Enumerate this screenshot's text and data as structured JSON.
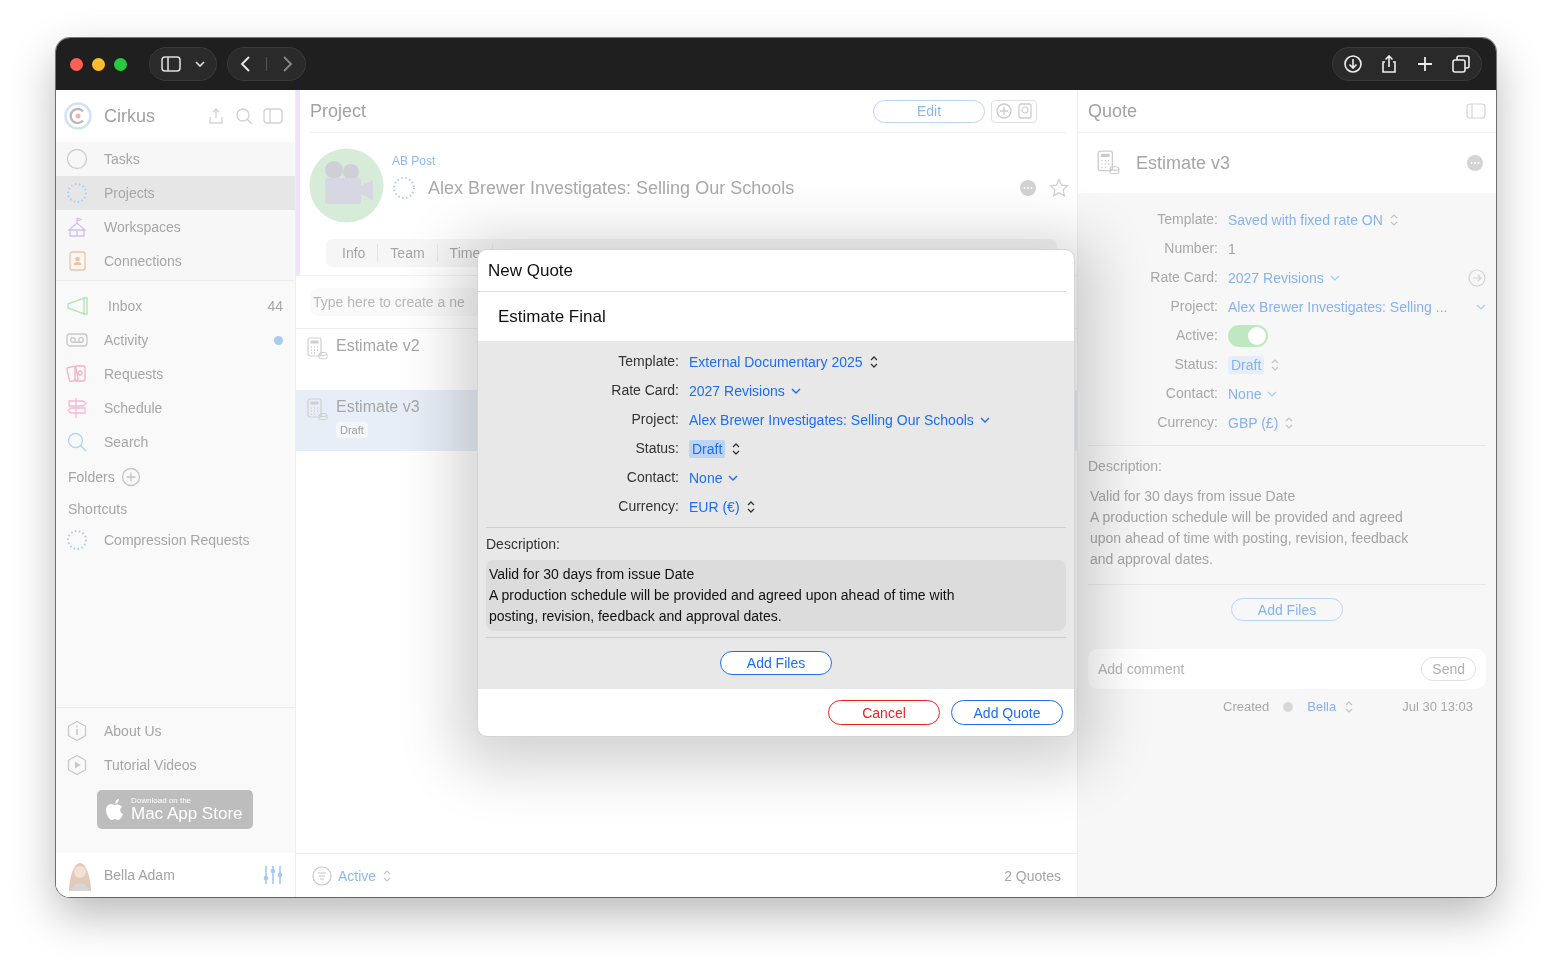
{
  "sidebar": {
    "app_name": "Cirkus",
    "nav": [
      {
        "label": "Tasks",
        "selected": false
      },
      {
        "label": "Projects",
        "selected": true
      },
      {
        "label": "Workspaces",
        "selected": false
      },
      {
        "label": "Connections",
        "selected": false
      }
    ],
    "inbox": [
      {
        "label": "Inbox",
        "count": "44",
        "unread": false
      },
      {
        "label": "Activity",
        "unread": true
      },
      {
        "label": "Requests",
        "unread": false
      },
      {
        "label": "Schedule",
        "unread": false
      },
      {
        "label": "Search",
        "unread": false
      }
    ],
    "folders_label": "Folders",
    "shortcuts_label": "Shortcuts",
    "shortcuts": [
      {
        "label": "Compression Requests"
      }
    ],
    "footer_links": [
      {
        "label": "About Us"
      },
      {
        "label": "Tutorial Videos"
      }
    ],
    "store_badge": {
      "small": "Download on the",
      "large": "Mac App Store"
    },
    "user": {
      "name": "Bella Adam"
    }
  },
  "project": {
    "header": "Project",
    "edit_button": "Edit",
    "client": "AB Post",
    "title": "Alex Brewer Investigates: Selling Our Schools",
    "tabs": [
      {
        "label": "Info",
        "selected": false
      },
      {
        "label": "Team",
        "selected": false
      },
      {
        "label": "Time",
        "selected": false
      }
    ],
    "new_placeholder": "Type here to create a ne",
    "quotes": [
      {
        "name": "Estimate v2",
        "selected": false
      },
      {
        "name": "Estimate v3",
        "status": "Draft",
        "selected": true
      }
    ],
    "filter": "Active",
    "count": "2 Quotes"
  },
  "quote": {
    "header": "Quote",
    "name": "Estimate v3",
    "fields": [
      {
        "label": "Template:",
        "value": "Saved with fixed rate ON",
        "kind": "stepper"
      },
      {
        "label": "Number:",
        "value": "1",
        "kind": "text"
      },
      {
        "label": "Rate Card:",
        "value": "2027 Revisions",
        "kind": "linked"
      },
      {
        "label": "Project:",
        "value": "Alex Brewer Investigates: Selling ...",
        "kind": "wide"
      },
      {
        "label": "Active:",
        "kind": "toggle",
        "on": true
      },
      {
        "label": "Status:",
        "value": "Draft",
        "kind": "badge"
      },
      {
        "label": "Contact:",
        "value": "None",
        "kind": "dropdown"
      },
      {
        "label": "Currency:",
        "value": "GBP (£)",
        "kind": "stepper"
      }
    ],
    "description_label": "Description:",
    "description": "Valid for 30 days from issue Date\nA production schedule will be provided and agreed upon ahead of time with posting, revision, feedback and approval dates.",
    "add_files": "Add Files",
    "comment_placeholder": "Add comment",
    "send": "Send",
    "history": {
      "event": "Created",
      "user": "Bella",
      "time": "Jul 30 13:03"
    }
  },
  "dialog": {
    "title": "New Quote",
    "name": "Estimate Final",
    "fields": [
      {
        "label": "Template:",
        "value": "External Documentary 2025",
        "kind": "stepper"
      },
      {
        "label": "Rate Card:",
        "value": "2027 Revisions",
        "kind": "dropdown"
      },
      {
        "label": "Project:",
        "value": "Alex Brewer Investigates: Selling Our Schools",
        "kind": "dropdown"
      },
      {
        "label": "Status:",
        "value": "Draft",
        "kind": "badge"
      },
      {
        "label": "Contact:",
        "value": "None",
        "kind": "dropdown"
      },
      {
        "label": "Currency:",
        "value": "EUR (€)",
        "kind": "stepper"
      }
    ],
    "description_label": "Description:",
    "description": "Valid for 30 days from issue Date\nA production schedule will be provided and agreed upon ahead of time with posting, revision, feedback and approval dates.",
    "add_files": "Add Files",
    "cancel": "Cancel",
    "confirm": "Add Quote"
  }
}
